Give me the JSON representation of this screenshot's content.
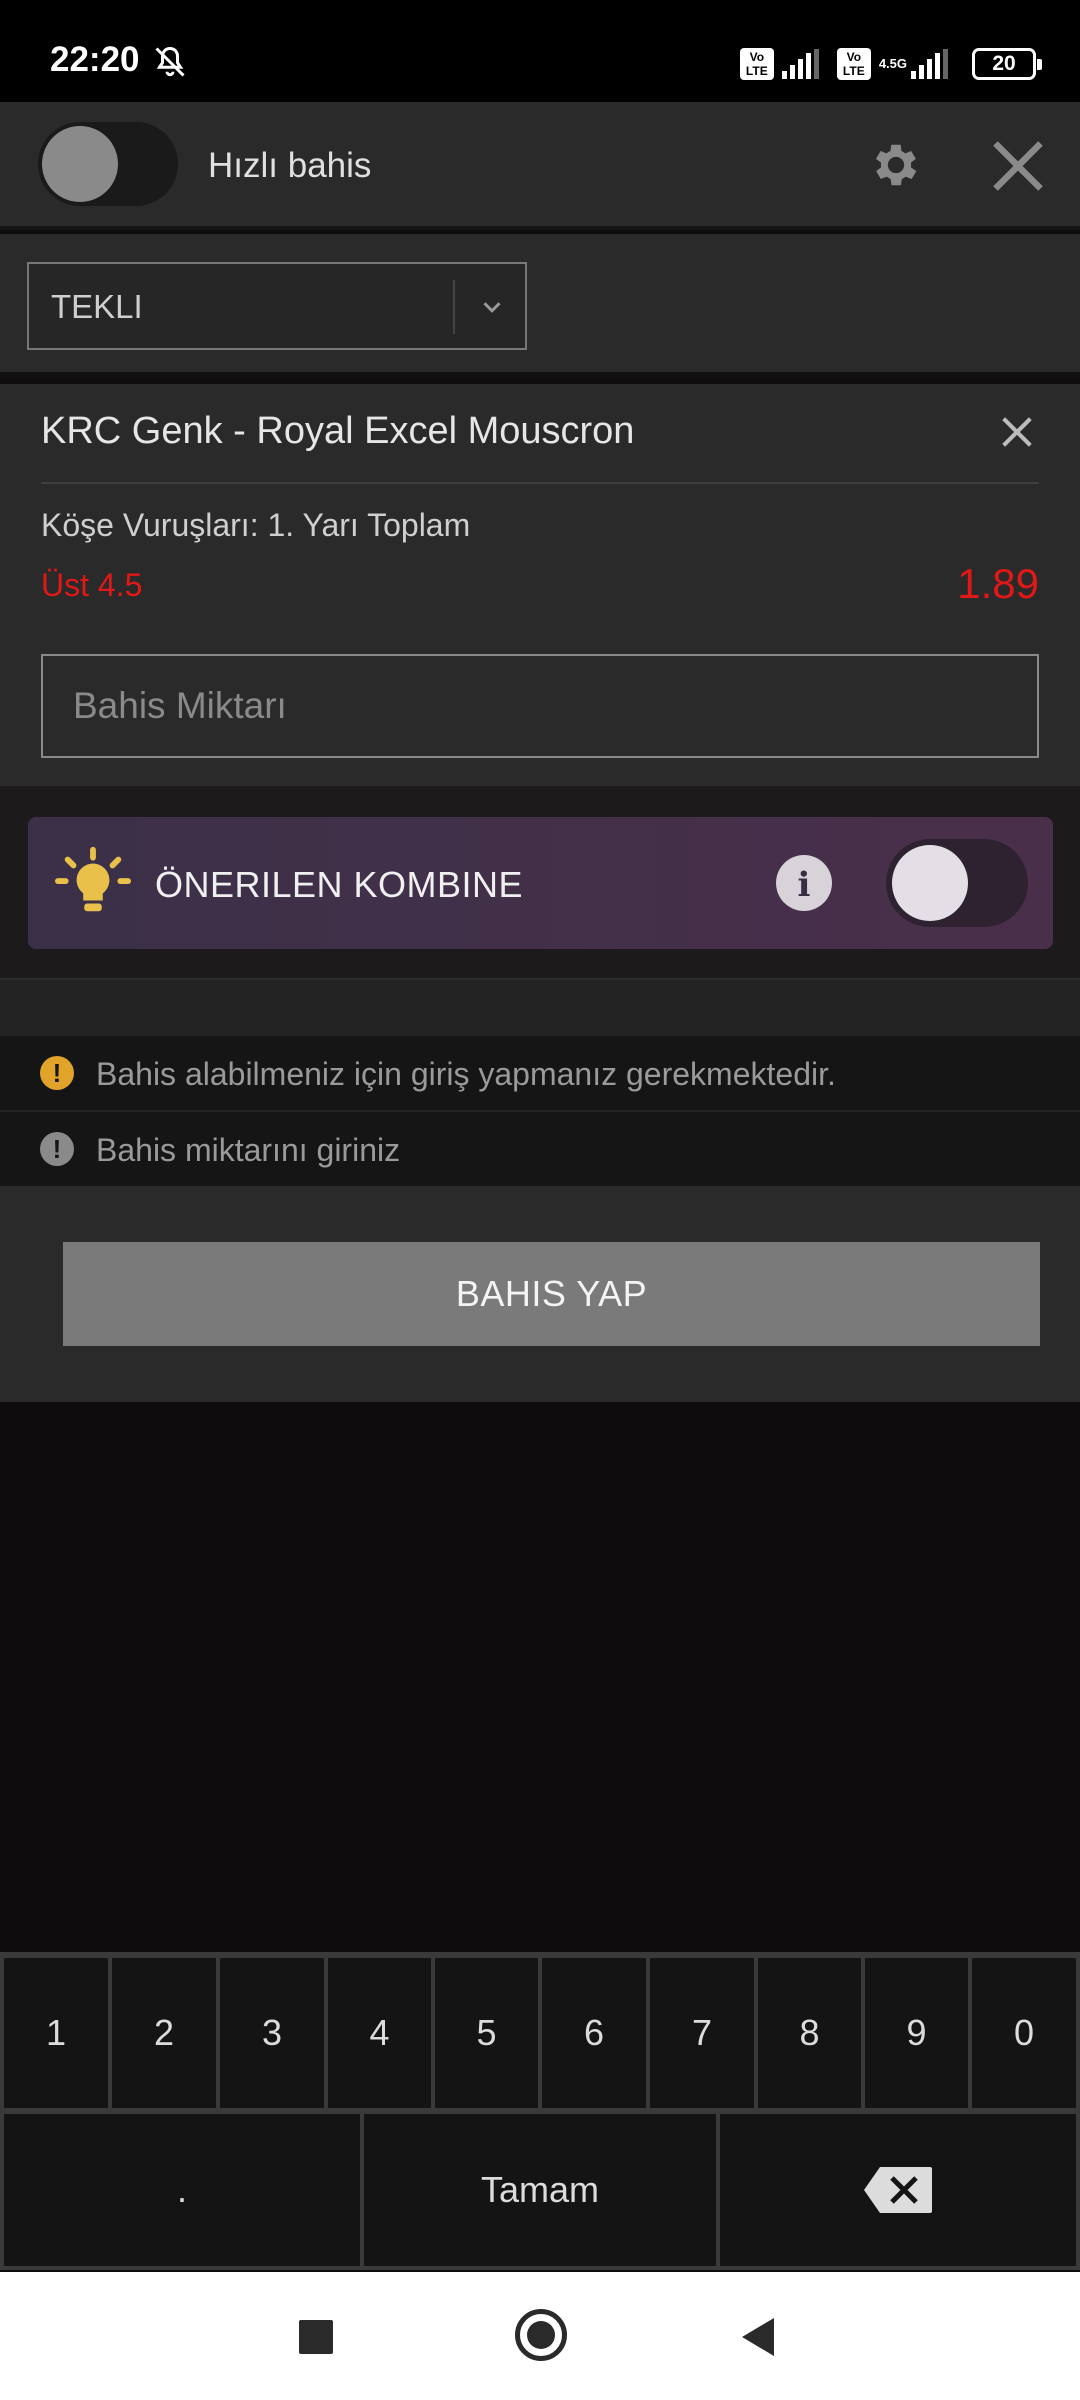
{
  "status_bar": {
    "time": "22:20",
    "volte_label": "Vo\nLTE",
    "network_label": "4.5G",
    "battery": "20"
  },
  "header": {
    "quick_bet_label": "Hızlı bahis",
    "quick_bet_on": false
  },
  "bet_type": {
    "selected": "TEKLI"
  },
  "bet_card": {
    "match": "KRC Genk - Royal Excel Mouscron",
    "market": "Köşe Vuruşları: 1. Yarı Toplam",
    "selection": "Üst 4.5",
    "odds": "1.89",
    "amount_placeholder": "Bahis Miktarı",
    "amount_value": ""
  },
  "kombine": {
    "label": "ÖNERILEN KOMBINE",
    "info_glyph": "i",
    "enabled": false
  },
  "messages": [
    {
      "text": "Bahis alabilmeniz için giriş yapmanız gerekmektedir.",
      "icon": "warning-icon",
      "color": "#e2a32a"
    },
    {
      "text": "Bahis miktarını giriniz",
      "icon": "warning-icon",
      "color": "#8a8a8a"
    }
  ],
  "bet_button": {
    "label": "BAHIS YAP"
  },
  "keypad": {
    "digits": [
      "1",
      "2",
      "3",
      "4",
      "5",
      "6",
      "7",
      "8",
      "9",
      "0"
    ],
    "dot": ".",
    "done": "Tamam"
  },
  "colors": {
    "accent_red": "#e01818",
    "warning_yellow": "#e2a32a",
    "bulb_yellow": "#e8c04a"
  }
}
